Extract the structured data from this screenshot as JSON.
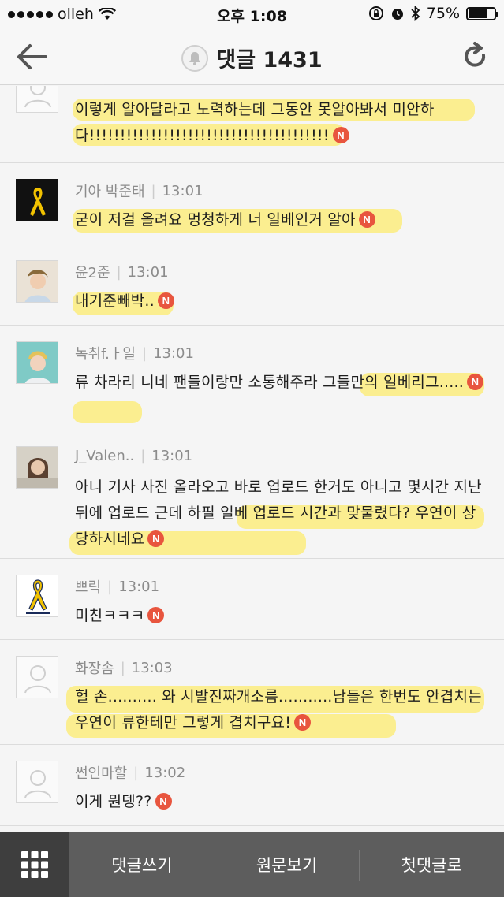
{
  "status": {
    "carrier": "olleh",
    "time": "오후 1:08",
    "battery": "75%",
    "battery_level": 0.75
  },
  "header": {
    "title": "댓글 1431"
  },
  "comments": [
    {
      "user": "",
      "time": "",
      "text": "이렇게 알아달라고 노력하는데 그동안 못알아봐서 미안하다!!!!!!!!!!!!!!!!!!!!!!!!!!!!!!!!!!!!!!!"
    },
    {
      "user": "기아 박준태",
      "time": "13:01",
      "text": "굳이 저걸 올려요 멍청하게 너 일베인거 알아"
    },
    {
      "user": "윤2준",
      "time": "13:01",
      "text": "내기준빼박.."
    },
    {
      "user": "녹취f.ㅏ일",
      "time": "13:01",
      "text": "류 차라리 니네 팬들이랑만 소통해주라 그들만의 일베리그....."
    },
    {
      "user": "J_Valen..",
      "time": "13:01",
      "text": "아니 기사 사진 올라오고 바로 업로드 한거도 아니고 몇시간 지난 뒤에 업로드 근데 하필 일베 업로드 시간과 맞물렸다? 우연이 상당하시네요"
    },
    {
      "user": "쁘릭",
      "time": "13:01",
      "text": "미친ㅋㅋㅋ"
    },
    {
      "user": "화장솜",
      "time": "13:03",
      "text": "헐 손.......... 와 시발진짜개소름...........남들은 한번도 안겹치는우연이 류한테만 그렇게 겹치구요!"
    },
    {
      "user": "썬인마할",
      "time": "13:02",
      "text": "이게 뭔뎅??"
    }
  ],
  "badge": "N",
  "tabbar": {
    "write": "댓글쓰기",
    "original": "원문보기",
    "first": "첫댓글로"
  }
}
